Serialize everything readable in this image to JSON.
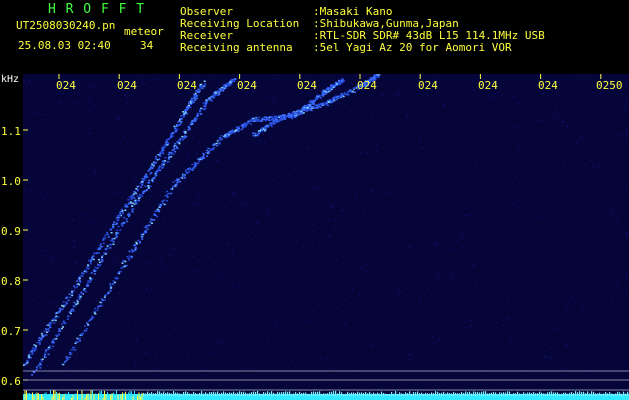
{
  "header": {
    "app_title": "H R O F F T",
    "filename": "UT2508030240.pn",
    "meteor_label": "meteor",
    "datetime": "25.08.03 02:40",
    "count": "34",
    "info": [
      {
        "key": "Observer",
        "value": ":Masaki Kano"
      },
      {
        "key": "Receiving Location",
        "value": ":Shibukawa,Gunma,Japan"
      },
      {
        "key": "Receiver",
        "value": ":RTL-SDR SDR# 43dB L15 114.1MHz USB"
      },
      {
        "key": "Receiving antenna",
        "value": ":5el Yagi Az 20 for Aomori VOR"
      }
    ]
  },
  "axes": {
    "y_unit": "kHz",
    "y_ticks": [
      "1.1",
      "1.0",
      "0.9",
      "0.8",
      "0.7",
      "0.6"
    ],
    "x_ticks": [
      "024",
      "024",
      "024",
      "024",
      "024",
      "024",
      "024",
      "024",
      "024",
      "0250"
    ]
  },
  "colors": {
    "background": "#000000",
    "label": "#ffff40",
    "title": "#40ff40",
    "noise": "#0a0a55",
    "trace": "#3a6cff",
    "baseline": "#30e8ff"
  }
}
